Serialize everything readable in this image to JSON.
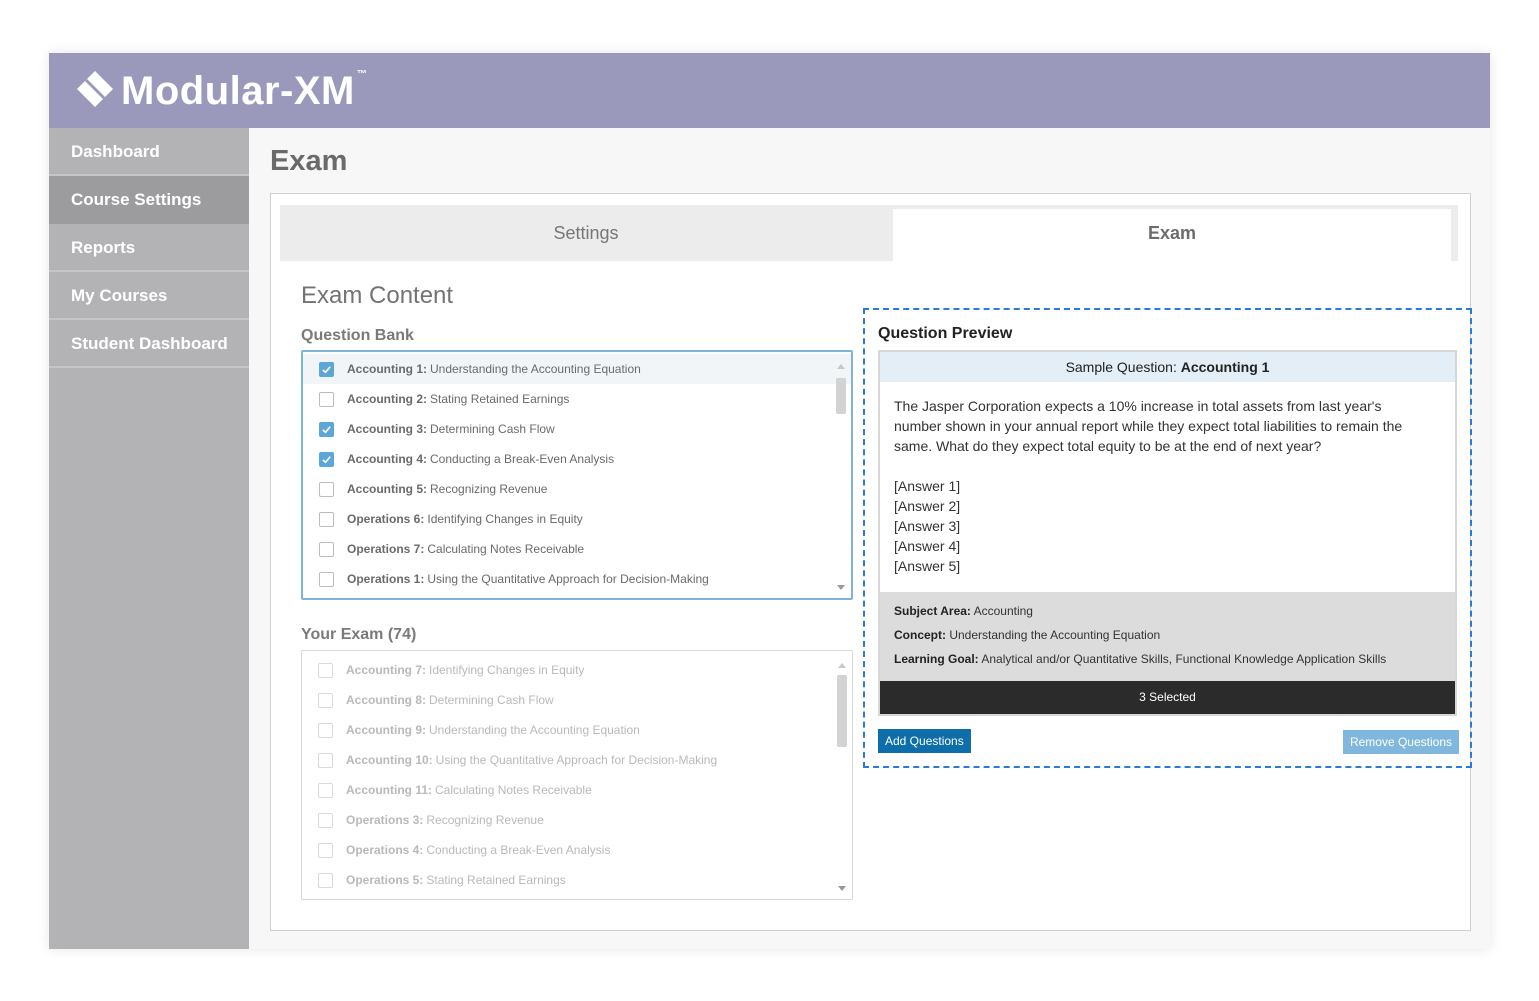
{
  "app": {
    "logo_text": "Modular-XM",
    "logo_tm": "™"
  },
  "sidebar": {
    "items": [
      {
        "label": "Dashboard"
      },
      {
        "label": "Course Settings"
      },
      {
        "label": "Reports"
      },
      {
        "label": "My Courses"
      },
      {
        "label": "Student Dashboard"
      }
    ],
    "active": "Course Settings"
  },
  "page": {
    "title": "Exam"
  },
  "tabs": {
    "settings": "Settings",
    "exam": "Exam"
  },
  "content": {
    "title": "Exam Content",
    "question_bank_label": "Question Bank",
    "your_exam_label": "Your Exam (74)"
  },
  "question_bank": [
    {
      "bold": "Accounting 1:",
      "text": "Understanding the Accounting Equation",
      "checked": true,
      "highlight": true
    },
    {
      "bold": "Accounting 2:",
      "text": "Stating Retained Earnings",
      "checked": false
    },
    {
      "bold": "Accounting 3:",
      "text": "Determining Cash Flow",
      "checked": true
    },
    {
      "bold": "Accounting 4:",
      "text": "Conducting a Break-Even Analysis",
      "checked": true
    },
    {
      "bold": "Accounting 5:",
      "text": "Recognizing Revenue",
      "checked": false
    },
    {
      "bold": "Operations 6:",
      "text": "Identifying Changes in Equity",
      "checked": false
    },
    {
      "bold": "Operations 7:",
      "text": "Calculating Notes Receivable",
      "checked": false
    },
    {
      "bold": "Operations 1:",
      "text": "Using the Quantitative Approach for Decision-Making",
      "checked": false
    }
  ],
  "your_exam": [
    {
      "bold": "Accounting 7:",
      "text": "Identifying Changes in Equity"
    },
    {
      "bold": "Accounting 8:",
      "text": "Determining Cash Flow"
    },
    {
      "bold": "Accounting 9:",
      "text": "Understanding the Accounting Equation"
    },
    {
      "bold": "Accounting 10:",
      "text": "Using the Quantitative Approach for Decision-Making"
    },
    {
      "bold": "Accounting 11:",
      "text": "Calculating Notes Receivable"
    },
    {
      "bold": "Operations 3:",
      "text": "Recognizing Revenue"
    },
    {
      "bold": "Operations 4:",
      "text": "Conducting a Break-Even Analysis"
    },
    {
      "bold": "Operations 5:",
      "text": "Stating Retained Earnings"
    }
  ],
  "preview": {
    "title": "Question Preview",
    "header_prefix": "Sample Question:",
    "header_bold": "Accounting 1",
    "question_lines": [
      "The Jasper Corporation expects a 10% increase in total assets from last year's",
      "number shown in your annual report while they expect total liabilities to remain the",
      "same. What do they expect total equity to be at the end of next year?"
    ],
    "answers": [
      "[Answer 1]",
      "[Answer 2]",
      "[Answer 3]",
      "[Answer 4]",
      "[Answer 5]"
    ],
    "subject_label": "Subject Area:",
    "subject_value": "Accounting",
    "concept_label": "Concept:",
    "concept_value": "Understanding the Accounting Equation",
    "goal_label": "Learning Goal:",
    "goal_value": "Analytical and/or Quantitative Skills, Functional Knowledge Application Skills",
    "selected_text": "3 Selected"
  },
  "buttons": {
    "add": "Add Questions",
    "remove": "Remove Questions"
  },
  "colors": {
    "header": "#9a99bb",
    "accent": "#5aa7d8",
    "dashed_border": "#2a7ad6",
    "add_button": "#0e6ea9",
    "remove_button": "#7fb8dc"
  }
}
